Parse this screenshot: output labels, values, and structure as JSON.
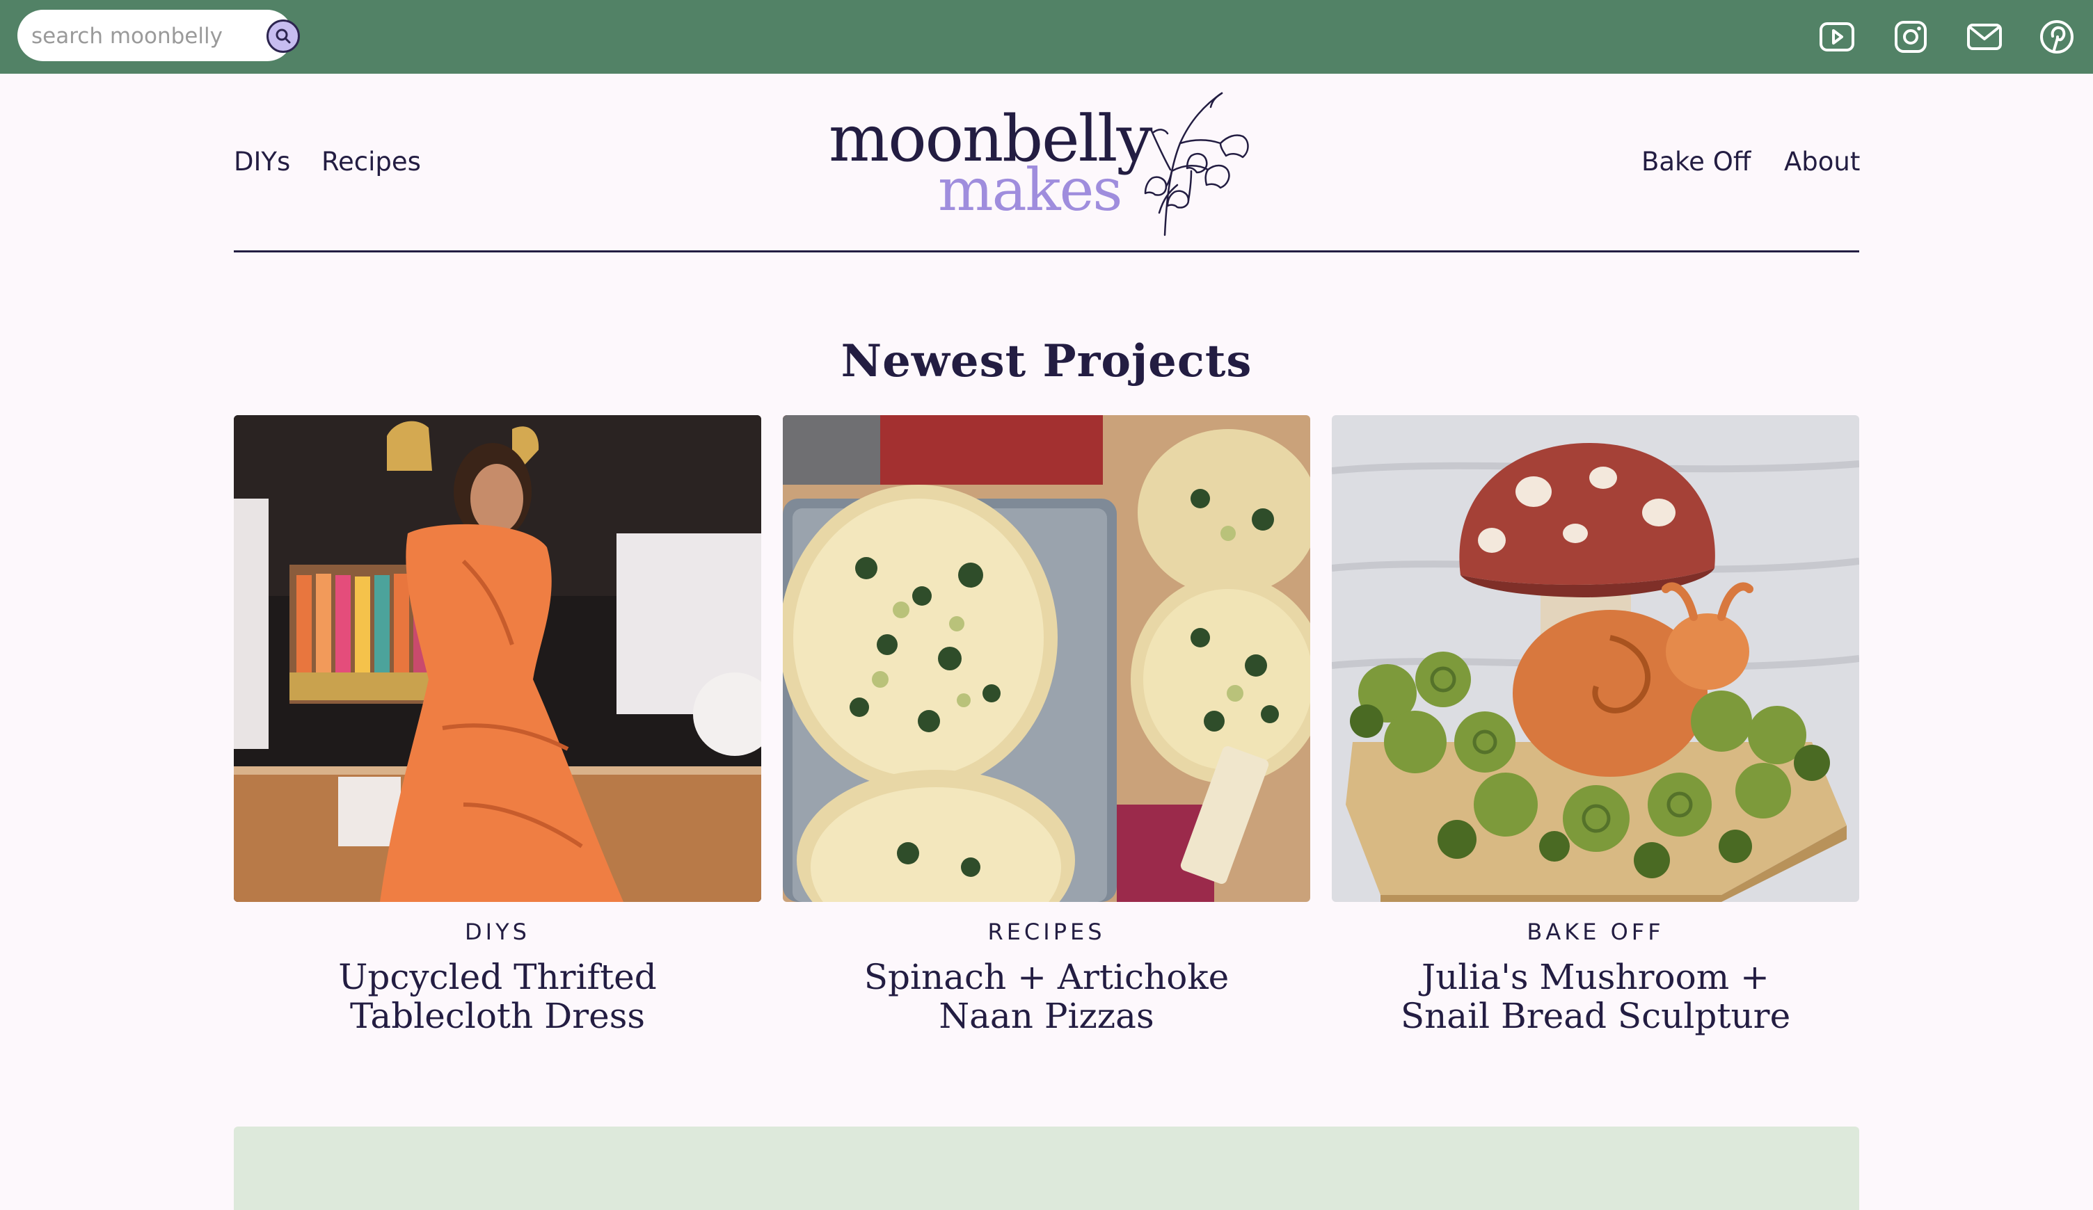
{
  "search": {
    "placeholder": "search moonbelly"
  },
  "social": [
    "youtube-icon",
    "instagram-icon",
    "mail-icon",
    "pinterest-icon"
  ],
  "nav": {
    "left": [
      {
        "label": "DIYs"
      },
      {
        "label": "Recipes"
      }
    ],
    "right": [
      {
        "label": "Bake Off"
      },
      {
        "label": "About"
      }
    ]
  },
  "logo": {
    "line1": "moonbelly",
    "line2": "makes"
  },
  "section": {
    "title": "Newest Projects"
  },
  "cards": [
    {
      "category": "DIYS",
      "title_line1": "Upcycled Thrifted",
      "title_line2": "Tablecloth Dress"
    },
    {
      "category": "RECIPES",
      "title_line1": "Spinach + Artichoke",
      "title_line2": "Naan Pizzas"
    },
    {
      "category": "BAKE OFF",
      "title_line1": "Julia's Mushroom +",
      "title_line2": "Snail Bread Sculpture"
    }
  ],
  "colors": {
    "topbar": "#528266",
    "accent": "#9f8ddd",
    "text": "#231d42",
    "background": "#fdf8fc",
    "footer_band": "#dde9db"
  }
}
